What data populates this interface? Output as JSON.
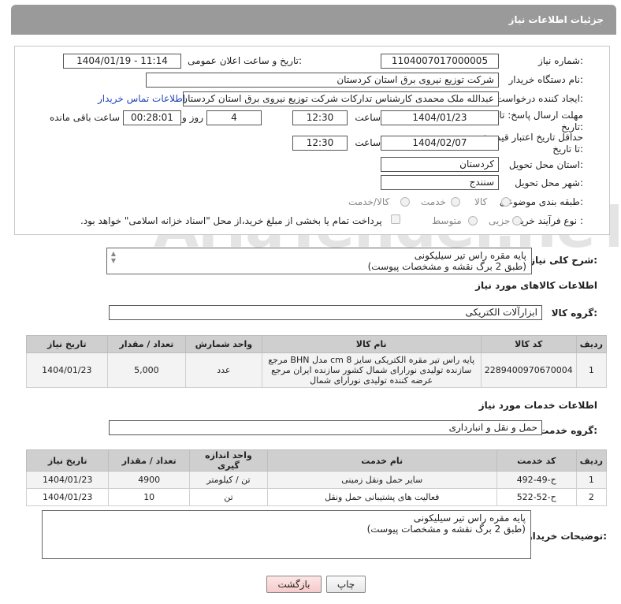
{
  "header": {
    "title": "جزئیات اطلاعات نیاز"
  },
  "form": {
    "need_number_label": "شماره نیاز:",
    "need_number": "1104007017000005",
    "announce_label": "تاریخ و ساعت اعلان عمومی:",
    "announce_value": "1404/01/19 - 11:14",
    "buyer_org_label": "نام دستگاه خریدار:",
    "buyer_org": "شرکت توزیع نیروی برق استان کردستان",
    "creator_label": "ایجاد کننده درخواست:",
    "creator": "عبدالله ملک محمدی کارشناس تدارکات شرکت توزیع نیروی برق استان کردستان",
    "contact_link": "اطلاعات تماس خریدار",
    "deadline_label": "مهلت ارسال پاسخ: تا تاریخ:",
    "deadline_date": "1404/01/23",
    "time_label": "ساعت",
    "deadline_time": "12:30",
    "days_value": "4",
    "days_label": "روز و",
    "remaining_time": "00:28:01",
    "remaining_label": "ساعت باقی مانده",
    "validity_label": "حداقل تاریخ اعتبار قیمت: تا تاریخ:",
    "validity_date": "1404/02/07",
    "validity_time": "12:30",
    "province_label": "استان محل تحویل:",
    "province": "کردستان",
    "city_label": "شهر محل تحویل:",
    "city": "سنندج",
    "category_label": "طبقه بندی موضوعی:",
    "category_options": [
      "کالا",
      "خدمت",
      "کالا/خدمت"
    ],
    "process_label": "نوع فرآیند خرید :",
    "process_options": [
      "جزیی",
      "متوسط"
    ],
    "payment_note": "پرداخت تمام یا بخشی از مبلغ خرید،از محل \"اسناد خزانه اسلامی\" خواهد بود."
  },
  "description": {
    "label": "شرح کلی نیاز:",
    "text_line1": "پایه مقره راس تیر سیلیکونی",
    "text_line2": "(طبق 2 برگ نقشه و مشخصات پیوست)"
  },
  "goods": {
    "section_title": "اطلاعات کالاهای مورد نیاز",
    "group_label": "گروه کالا:",
    "group_value": "ابزارآلات الکتریکی",
    "columns": [
      "ردیف",
      "کد کالا",
      "نام کالا",
      "واحد شمارش",
      "تعداد / مقدار",
      "تاریخ نیاز"
    ],
    "rows": [
      {
        "idx": "1",
        "code": "2289400970670004",
        "name": "پایه راس تیر مقره الکتریکی سایز cm 8 مدل BHN مرجع سازنده تولیدی نورارای شمال کشور سازنده ایران مرجع عرضه کننده تولیدی نورارای شمال",
        "unit": "عدد",
        "qty": "5,000",
        "date": "1404/01/23"
      }
    ]
  },
  "services": {
    "section_title": "اطلاعات خدمات مورد نیاز",
    "group_label": "گروه خدمت:",
    "group_value": "حمل و نقل و انبارداری",
    "columns": [
      "ردیف",
      "کد خدمت",
      "نام خدمت",
      "واحد اندازه گیری",
      "تعداد / مقدار",
      "تاریخ نیاز"
    ],
    "rows": [
      {
        "idx": "1",
        "code": "ح-49-492",
        "name": "سایر حمل ونقل زمینی",
        "unit": "تن / کیلومتر",
        "qty": "4900",
        "date": "1404/01/23"
      },
      {
        "idx": "2",
        "code": "ح-52-522",
        "name": "فعالیت های پشتیبانی حمل ونقل",
        "unit": "تن",
        "qty": "10",
        "date": "1404/01/23"
      }
    ]
  },
  "buyer_notes": {
    "label": "توضیحات خریدار:",
    "line1": "پایه مقره راس تیر سیلیکونی",
    "line2": "(طبق 2 برگ نقشه و مشخصات پیوست)"
  },
  "buttons": {
    "print": "چاپ",
    "back": "بازگشت"
  },
  "watermark": {
    "text": "AriaTender.neT"
  }
}
